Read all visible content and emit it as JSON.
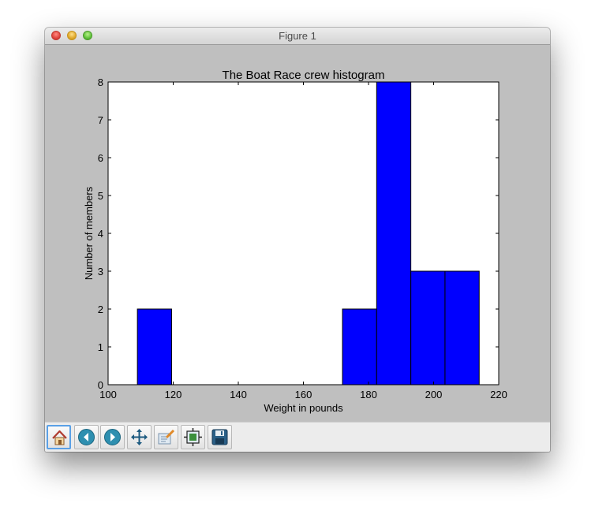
{
  "window": {
    "title": "Figure 1"
  },
  "toolbar": {
    "buttons": [
      {
        "name": "home-button",
        "icon": "home-icon"
      },
      {
        "name": "back-button",
        "icon": "back-arrow-icon"
      },
      {
        "name": "forward-button",
        "icon": "forward-arrow-icon"
      },
      {
        "name": "pan-button",
        "icon": "move-arrows-icon"
      },
      {
        "name": "zoom-rect-button",
        "icon": "zoom-to-rect-icon"
      },
      {
        "name": "subplots-button",
        "icon": "configure-subplots-icon"
      },
      {
        "name": "save-button",
        "icon": "floppy-disk-icon"
      }
    ]
  },
  "colors": {
    "bar": "#0000ff",
    "figure_bg": "#bfbfbf",
    "axes_bg": "#ffffff"
  },
  "chart_data": {
    "type": "bar",
    "title": "The Boat Race crew histogram",
    "xlabel": "Weight in pounds",
    "ylabel": "Number of members",
    "xlim": [
      100,
      220
    ],
    "ylim": [
      0,
      8
    ],
    "xticks": [
      "100",
      "120",
      "140",
      "160",
      "180",
      "200",
      "220"
    ],
    "yticks": [
      "0",
      "1",
      "2",
      "3",
      "4",
      "5",
      "6",
      "7",
      "8"
    ],
    "bins": [
      {
        "x0": 109,
        "x1": 119.5,
        "count": 2
      },
      {
        "x0": 119.5,
        "x1": 130,
        "count": 0
      },
      {
        "x0": 130,
        "x1": 140.5,
        "count": 0
      },
      {
        "x0": 140.5,
        "x1": 151,
        "count": 0
      },
      {
        "x0": 151,
        "x1": 161.5,
        "count": 0
      },
      {
        "x0": 161.5,
        "x1": 172,
        "count": 0
      },
      {
        "x0": 172,
        "x1": 182.5,
        "count": 2
      },
      {
        "x0": 182.5,
        "x1": 193,
        "count": 8
      },
      {
        "x0": 193,
        "x1": 203.5,
        "count": 3
      },
      {
        "x0": 203.5,
        "x1": 214,
        "count": 3
      }
    ],
    "grid": false
  }
}
